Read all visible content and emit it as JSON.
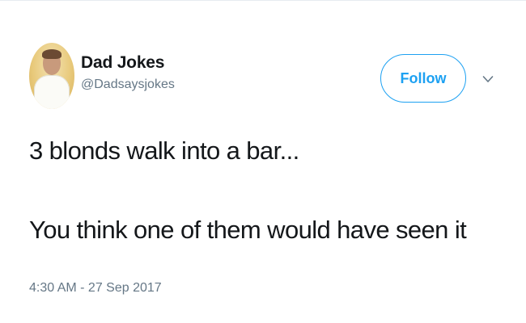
{
  "author": {
    "display_name": "Dad Jokes",
    "handle": "@Dadsaysjokes",
    "avatar_icon": "person-photo-avatar"
  },
  "actions": {
    "follow_label": "Follow",
    "more_icon": "chevron-down-icon"
  },
  "tweet": {
    "line1": "3 blonds walk into a bar...",
    "line2": "You think one of them would have seen it",
    "timestamp": "4:30 AM - 27 Sep 2017"
  },
  "colors": {
    "accent": "#1da1f2",
    "text": "#14171a",
    "secondary_text": "#657786"
  }
}
